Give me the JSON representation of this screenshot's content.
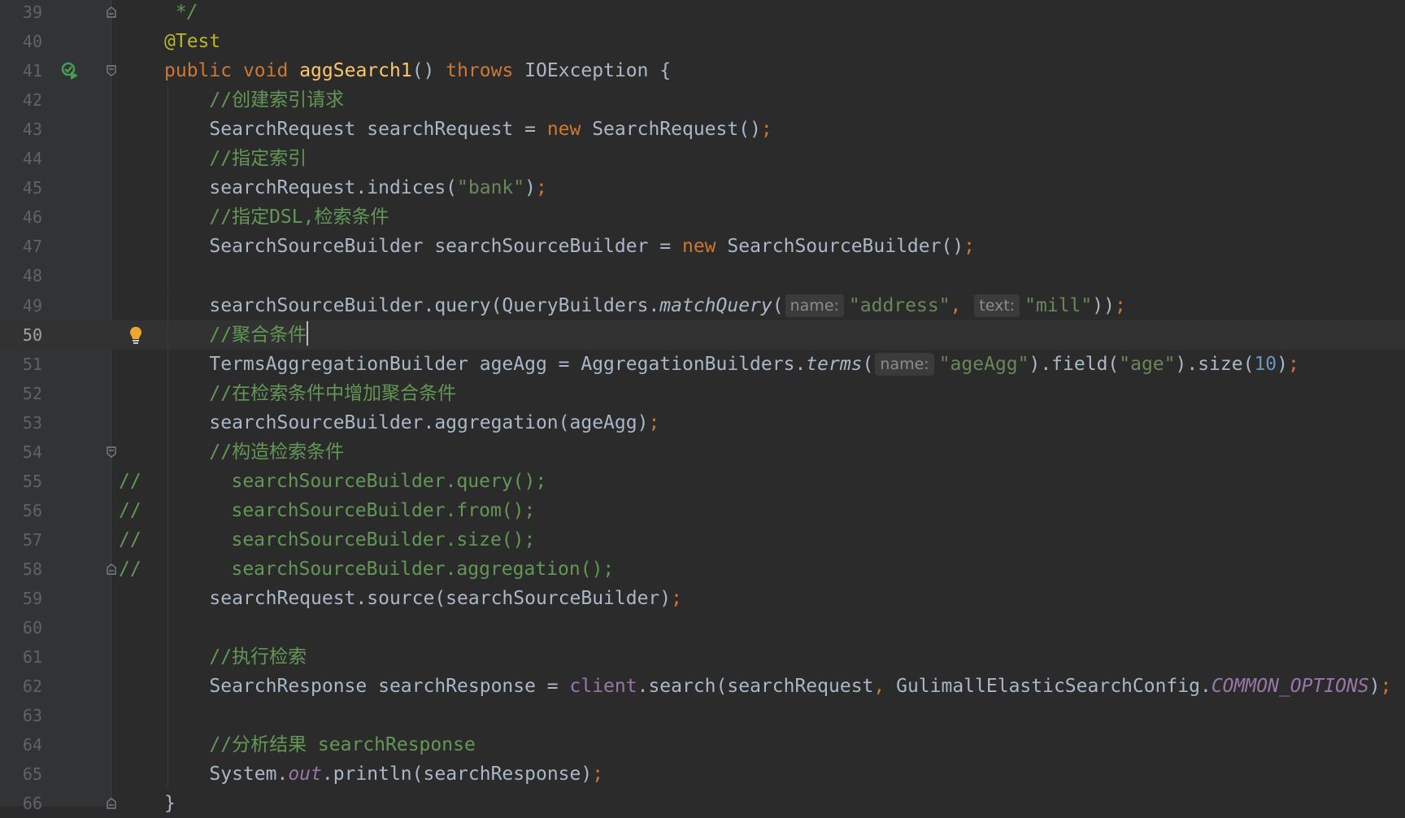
{
  "editor": {
    "lines": [
      {
        "num": "39",
        "tokens": [
          {
            "t": " */",
            "cls": "c it"
          }
        ]
      },
      {
        "num": "40",
        "tokens": [
          {
            "t": "@Test",
            "cls": "a"
          }
        ]
      },
      {
        "num": "41",
        "tokens": [
          {
            "t": "public",
            "cls": "k"
          },
          {
            "t": " "
          },
          {
            "t": "void",
            "cls": "k"
          },
          {
            "t": " "
          },
          {
            "t": "aggSearch1",
            "cls": "m"
          },
          {
            "t": "() "
          },
          {
            "t": "throws",
            "cls": "k"
          },
          {
            "t": " IOException {"
          }
        ]
      },
      {
        "num": "42",
        "tokens": [
          {
            "t": "    //创建索引请求",
            "cls": "c"
          }
        ]
      },
      {
        "num": "43",
        "tokens": [
          {
            "t": "    SearchRequest searchRequest = "
          },
          {
            "t": "new",
            "cls": "k"
          },
          {
            "t": " SearchRequest()"
          },
          {
            "t": ";",
            "cls": "k"
          }
        ]
      },
      {
        "num": "44",
        "tokens": [
          {
            "t": "    //指定索引",
            "cls": "c"
          }
        ]
      },
      {
        "num": "45",
        "tokens": [
          {
            "t": "    searchRequest.indices("
          },
          {
            "t": "\"bank\"",
            "cls": "s"
          },
          {
            "t": ")"
          },
          {
            "t": ";",
            "cls": "k"
          }
        ]
      },
      {
        "num": "46",
        "tokens": [
          {
            "t": "    //指定DSL,检索条件",
            "cls": "c"
          }
        ]
      },
      {
        "num": "47",
        "tokens": [
          {
            "t": "    SearchSourceBuilder searchSourceBuilder = "
          },
          {
            "t": "new",
            "cls": "k"
          },
          {
            "t": " SearchSourceBuilder()"
          },
          {
            "t": ";",
            "cls": "k"
          }
        ]
      },
      {
        "num": "48",
        "tokens": []
      },
      {
        "num": "49",
        "tokens": [
          {
            "t": "    searchSourceBuilder.query(QueryBuilders."
          },
          {
            "t": "matchQuery",
            "cls": "it"
          },
          {
            "t": "("
          },
          {
            "hint": "name:"
          },
          {
            "t": "\"address\"",
            "cls": "s"
          },
          {
            "t": ",",
            "cls": "k"
          },
          {
            "t": " "
          },
          {
            "hint": "text:"
          },
          {
            "t": "\"mill\"",
            "cls": "s"
          },
          {
            "t": "))"
          },
          {
            "t": ";",
            "cls": "k"
          }
        ]
      },
      {
        "num": "50",
        "current": true,
        "tokens": [
          {
            "t": "    //聚合条件",
            "cls": "c"
          },
          {
            "caret": true
          }
        ]
      },
      {
        "num": "51",
        "tokens": [
          {
            "t": "    TermsAggregationBuilder ageAgg = AggregationBuilders."
          },
          {
            "t": "terms",
            "cls": "it"
          },
          {
            "t": "("
          },
          {
            "hint": "name:"
          },
          {
            "t": "\"ageAgg\"",
            "cls": "s"
          },
          {
            "t": ").field("
          },
          {
            "t": "\"age\"",
            "cls": "s"
          },
          {
            "t": ").size("
          },
          {
            "t": "10",
            "cls": "n"
          },
          {
            "t": ")"
          },
          {
            "t": ";",
            "cls": "k"
          }
        ]
      },
      {
        "num": "52",
        "tokens": [
          {
            "t": "    //在检索条件中增加聚合条件",
            "cls": "c"
          }
        ]
      },
      {
        "num": "53",
        "tokens": [
          {
            "t": "    searchSourceBuilder.aggregation(ageAgg)"
          },
          {
            "t": ";",
            "cls": "k"
          }
        ]
      },
      {
        "num": "54",
        "tokens": [
          {
            "t": "    //构造检索条件",
            "cls": "c"
          }
        ]
      },
      {
        "num": "55",
        "tokens": [
          {
            "t": "//        searchSourceBuilder.query();",
            "cls": "c"
          }
        ],
        "lineComment": true
      },
      {
        "num": "56",
        "tokens": [
          {
            "t": "//        searchSourceBuilder.from();",
            "cls": "c"
          }
        ],
        "lineComment": true
      },
      {
        "num": "57",
        "tokens": [
          {
            "t": "//        searchSourceBuilder.size();",
            "cls": "c"
          }
        ],
        "lineComment": true
      },
      {
        "num": "58",
        "tokens": [
          {
            "t": "//        searchSourceBuilder.aggregation();",
            "cls": "c"
          }
        ],
        "lineComment": true
      },
      {
        "num": "59",
        "tokens": [
          {
            "t": "    searchRequest.source(searchSourceBuilder)"
          },
          {
            "t": ";",
            "cls": "k"
          }
        ]
      },
      {
        "num": "60",
        "tokens": []
      },
      {
        "num": "61",
        "tokens": [
          {
            "t": "    //执行检索",
            "cls": "c"
          }
        ]
      },
      {
        "num": "62",
        "tokens": [
          {
            "t": "    SearchResponse searchResponse = "
          },
          {
            "t": "client",
            "cls": "f"
          },
          {
            "t": ".search(searchRequest"
          },
          {
            "t": ",",
            "cls": "k"
          },
          {
            "t": " GulimallElasticSearchConfig."
          },
          {
            "t": "COMMON_OPTIONS",
            "cls": "fi"
          },
          {
            "t": ")"
          },
          {
            "t": ";",
            "cls": "k"
          }
        ]
      },
      {
        "num": "63",
        "tokens": []
      },
      {
        "num": "64",
        "tokens": [
          {
            "t": "    //分析结果 searchResponse",
            "cls": "c"
          }
        ]
      },
      {
        "num": "65",
        "tokens": [
          {
            "t": "    System."
          },
          {
            "t": "out",
            "cls": "fi"
          },
          {
            "t": ".println(searchResponse)"
          },
          {
            "t": ";",
            "cls": "k"
          }
        ]
      },
      {
        "num": "66",
        "tokens": [
          {
            "t": "}"
          }
        ]
      }
    ],
    "gutter_icons": {
      "run_line": "41",
      "bulb_line": "50",
      "fold_lines": [
        "39",
        "41",
        "54",
        "58",
        "66"
      ]
    }
  }
}
